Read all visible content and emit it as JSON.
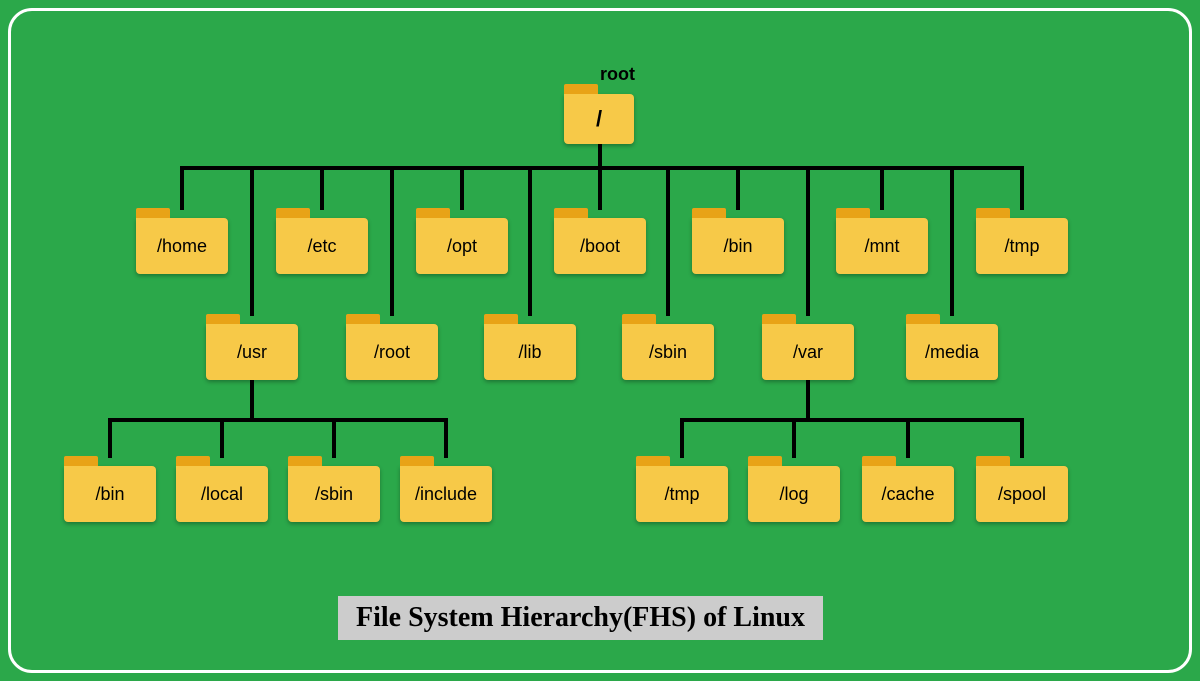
{
  "title": "File System Hierarchy(FHS) of Linux",
  "root": {
    "label": "root",
    "path": "/"
  },
  "level1_row1": [
    {
      "label": "/home"
    },
    {
      "label": "/etc"
    },
    {
      "label": "/opt"
    },
    {
      "label": "/boot"
    },
    {
      "label": "/bin"
    },
    {
      "label": "/mnt"
    },
    {
      "label": "/tmp"
    }
  ],
  "level1_row2": [
    {
      "label": "/usr"
    },
    {
      "label": "/root"
    },
    {
      "label": "/lib"
    },
    {
      "label": "/sbin"
    },
    {
      "label": "/var"
    },
    {
      "label": "/media"
    }
  ],
  "usr_children": [
    {
      "label": "/bin"
    },
    {
      "label": "/local"
    },
    {
      "label": "/sbin"
    },
    {
      "label": "/include"
    }
  ],
  "var_children": [
    {
      "label": "/tmp"
    },
    {
      "label": "/log"
    },
    {
      "label": "/cache"
    },
    {
      "label": "/spool"
    }
  ],
  "colors": {
    "bg": "#2ba84a",
    "folder": "#f7c948",
    "tab": "#e8a317"
  }
}
